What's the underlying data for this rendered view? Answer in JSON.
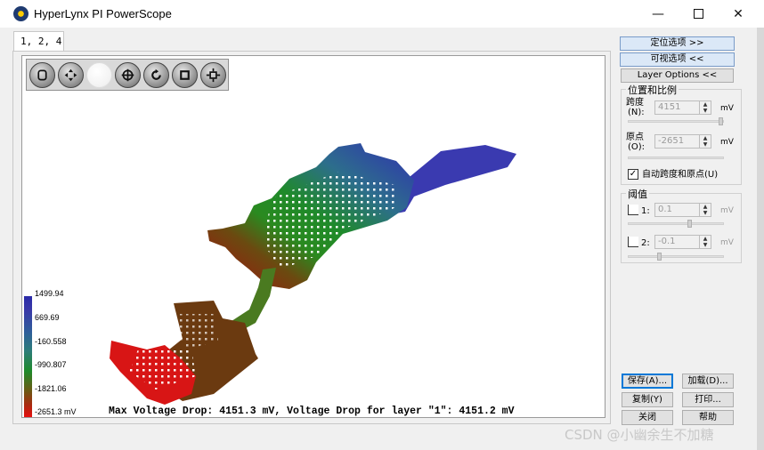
{
  "window": {
    "title": "HyperLynx PI PowerScope",
    "controls": {
      "minimize": "—",
      "maximize": "",
      "close": "✕"
    }
  },
  "tab": {
    "label": "1, 2, 4"
  },
  "toolbar": {
    "icons": [
      "pan-hand-icon",
      "move-icon",
      "blank-icon",
      "zoom-target-icon",
      "rotate-icon",
      "stop-icon",
      "fit-icon"
    ]
  },
  "legend": {
    "values": [
      "1499.94",
      "669.69",
      "-160.558",
      "-990.807",
      "-1821.06",
      "-2651.3 mV"
    ],
    "colors": [
      "#2b2ba8",
      "#2d7c7a",
      "#1f8a2a",
      "#e61010"
    ]
  },
  "footer": {
    "text": "Max Voltage Drop: 4151.3 mV, Voltage Drop for layer \"1\": 4151.2 mV"
  },
  "right_panel": {
    "btn_position_options": "定位选项 >>",
    "btn_visual_options": "可视选项 <<",
    "btn_layer_options": "Layer Options <<",
    "position_group": {
      "title": "位置和比例",
      "span_label": "跨度",
      "span_hotkey": "(N):",
      "span_value": "4151",
      "span_unit": "mV",
      "origin_label": "原点",
      "origin_hotkey": "(O):",
      "origin_value": "-2651",
      "origin_unit": "mV",
      "auto_checkbox_label": "自动跨度和原点(U)",
      "auto_checked": "✓"
    },
    "threshold_group": {
      "title": "阈值",
      "t1_label": "1:",
      "t1_value": "0.1",
      "t1_unit": "mV",
      "t2_label": "2:",
      "t2_value": "-0.1",
      "t2_unit": "mV"
    },
    "buttons": {
      "save": "保存(A)...",
      "load": "加载(D)...",
      "copy": "复制(Y)",
      "print": "打印...",
      "close": "关闭",
      "help": "帮助"
    }
  },
  "watermark": "CSDN @小幽余生不加糖"
}
